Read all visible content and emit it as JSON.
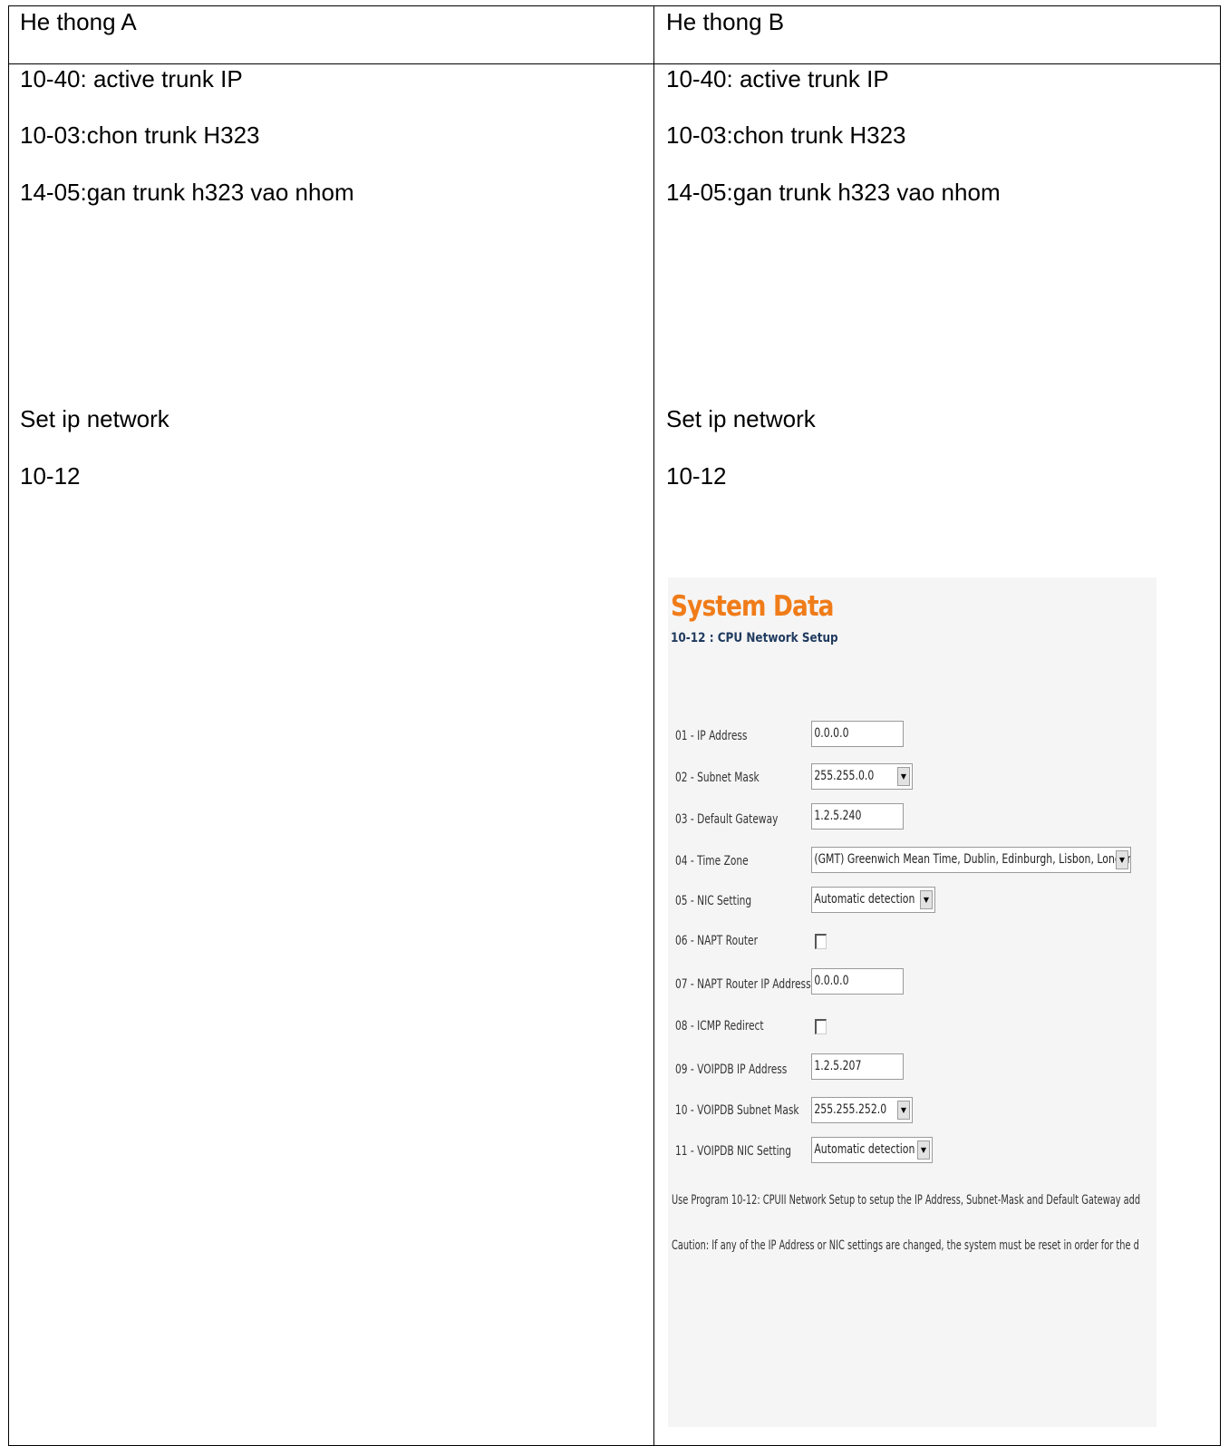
{
  "columns": [
    {
      "header": "He thong A",
      "lines": [
        "10-40: active trunk IP",
        "10-03:chon trunk H323",
        "14-05:gan trunk h323 vao nhom"
      ],
      "network_label": "Set ip network",
      "program_code": "10-12"
    },
    {
      "header": "He thong B",
      "lines": [
        "10-40: active trunk IP",
        "10-03:chon trunk H323",
        "14-05:gan trunk h323 vao nhom"
      ],
      "network_label": "Set ip network",
      "program_code": "10-12"
    }
  ],
  "screenshot": {
    "title": "System Data",
    "subtitle": "10-12 : CPU Network Setup",
    "title_color": "#f07c19",
    "fields": [
      {
        "label": "01 - IP Address",
        "type": "text",
        "value": "0.0.0.0"
      },
      {
        "label": "02 - Subnet Mask",
        "type": "select",
        "value": "255.255.0.0"
      },
      {
        "label": "03 - Default Gateway",
        "type": "text",
        "value": "1.2.5.240"
      },
      {
        "label": "04 - Time Zone",
        "type": "select",
        "value": "(GMT) Greenwich Mean Time, Dublin, Edinburgh, Lisbon, London"
      },
      {
        "label": "05 - NIC Setting",
        "type": "select",
        "value": "Automatic detection"
      },
      {
        "label": "06 - NAPT Router",
        "type": "checkbox",
        "checked": false
      },
      {
        "label": "07 - NAPT Router IP Address",
        "type": "text",
        "value": "0.0.0.0"
      },
      {
        "label": "08 - ICMP Redirect",
        "type": "checkbox",
        "checked": false
      },
      {
        "label": "09 - VOIPDB IP Address",
        "type": "text",
        "value": "1.2.5.207"
      },
      {
        "label": "10 - VOIPDB Subnet Mask",
        "type": "select",
        "value": "255.255.252.0"
      },
      {
        "label": "11 - VOIPDB NIC Setting",
        "type": "select",
        "value": "Automatic detection"
      }
    ],
    "note1": "Use Program 10-12: CPUII Network Setup to setup the IP Address, Subnet-Mask and Default Gateway add",
    "note2": "Caution: If any of the IP Address or NIC settings are changed, the system must be reset in order for the d"
  }
}
